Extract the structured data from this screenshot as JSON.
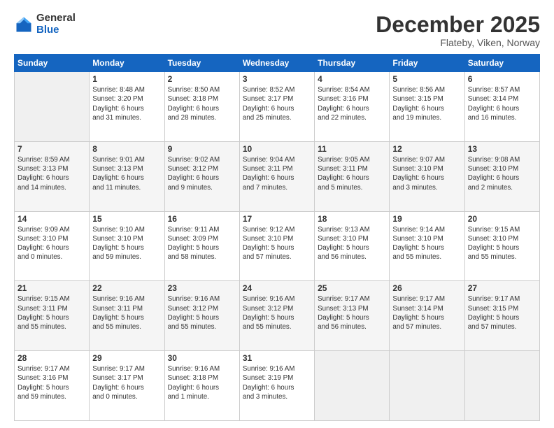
{
  "logo": {
    "general": "General",
    "blue": "Blue"
  },
  "title": {
    "month": "December 2025",
    "location": "Flateby, Viken, Norway"
  },
  "header_days": [
    "Sunday",
    "Monday",
    "Tuesday",
    "Wednesday",
    "Thursday",
    "Friday",
    "Saturday"
  ],
  "weeks": [
    [
      {
        "day": "",
        "info": ""
      },
      {
        "day": "1",
        "info": "Sunrise: 8:48 AM\nSunset: 3:20 PM\nDaylight: 6 hours\nand 31 minutes."
      },
      {
        "day": "2",
        "info": "Sunrise: 8:50 AM\nSunset: 3:18 PM\nDaylight: 6 hours\nand 28 minutes."
      },
      {
        "day": "3",
        "info": "Sunrise: 8:52 AM\nSunset: 3:17 PM\nDaylight: 6 hours\nand 25 minutes."
      },
      {
        "day": "4",
        "info": "Sunrise: 8:54 AM\nSunset: 3:16 PM\nDaylight: 6 hours\nand 22 minutes."
      },
      {
        "day": "5",
        "info": "Sunrise: 8:56 AM\nSunset: 3:15 PM\nDaylight: 6 hours\nand 19 minutes."
      },
      {
        "day": "6",
        "info": "Sunrise: 8:57 AM\nSunset: 3:14 PM\nDaylight: 6 hours\nand 16 minutes."
      }
    ],
    [
      {
        "day": "7",
        "info": "Sunrise: 8:59 AM\nSunset: 3:13 PM\nDaylight: 6 hours\nand 14 minutes."
      },
      {
        "day": "8",
        "info": "Sunrise: 9:01 AM\nSunset: 3:13 PM\nDaylight: 6 hours\nand 11 minutes."
      },
      {
        "day": "9",
        "info": "Sunrise: 9:02 AM\nSunset: 3:12 PM\nDaylight: 6 hours\nand 9 minutes."
      },
      {
        "day": "10",
        "info": "Sunrise: 9:04 AM\nSunset: 3:11 PM\nDaylight: 6 hours\nand 7 minutes."
      },
      {
        "day": "11",
        "info": "Sunrise: 9:05 AM\nSunset: 3:11 PM\nDaylight: 6 hours\nand 5 minutes."
      },
      {
        "day": "12",
        "info": "Sunrise: 9:07 AM\nSunset: 3:10 PM\nDaylight: 6 hours\nand 3 minutes."
      },
      {
        "day": "13",
        "info": "Sunrise: 9:08 AM\nSunset: 3:10 PM\nDaylight: 6 hours\nand 2 minutes."
      }
    ],
    [
      {
        "day": "14",
        "info": "Sunrise: 9:09 AM\nSunset: 3:10 PM\nDaylight: 6 hours\nand 0 minutes."
      },
      {
        "day": "15",
        "info": "Sunrise: 9:10 AM\nSunset: 3:10 PM\nDaylight: 5 hours\nand 59 minutes."
      },
      {
        "day": "16",
        "info": "Sunrise: 9:11 AM\nSunset: 3:09 PM\nDaylight: 5 hours\nand 58 minutes."
      },
      {
        "day": "17",
        "info": "Sunrise: 9:12 AM\nSunset: 3:10 PM\nDaylight: 5 hours\nand 57 minutes."
      },
      {
        "day": "18",
        "info": "Sunrise: 9:13 AM\nSunset: 3:10 PM\nDaylight: 5 hours\nand 56 minutes."
      },
      {
        "day": "19",
        "info": "Sunrise: 9:14 AM\nSunset: 3:10 PM\nDaylight: 5 hours\nand 55 minutes."
      },
      {
        "day": "20",
        "info": "Sunrise: 9:15 AM\nSunset: 3:10 PM\nDaylight: 5 hours\nand 55 minutes."
      }
    ],
    [
      {
        "day": "21",
        "info": "Sunrise: 9:15 AM\nSunset: 3:11 PM\nDaylight: 5 hours\nand 55 minutes."
      },
      {
        "day": "22",
        "info": "Sunrise: 9:16 AM\nSunset: 3:11 PM\nDaylight: 5 hours\nand 55 minutes."
      },
      {
        "day": "23",
        "info": "Sunrise: 9:16 AM\nSunset: 3:12 PM\nDaylight: 5 hours\nand 55 minutes."
      },
      {
        "day": "24",
        "info": "Sunrise: 9:16 AM\nSunset: 3:12 PM\nDaylight: 5 hours\nand 55 minutes."
      },
      {
        "day": "25",
        "info": "Sunrise: 9:17 AM\nSunset: 3:13 PM\nDaylight: 5 hours\nand 56 minutes."
      },
      {
        "day": "26",
        "info": "Sunrise: 9:17 AM\nSunset: 3:14 PM\nDaylight: 5 hours\nand 57 minutes."
      },
      {
        "day": "27",
        "info": "Sunrise: 9:17 AM\nSunset: 3:15 PM\nDaylight: 5 hours\nand 57 minutes."
      }
    ],
    [
      {
        "day": "28",
        "info": "Sunrise: 9:17 AM\nSunset: 3:16 PM\nDaylight: 5 hours\nand 59 minutes."
      },
      {
        "day": "29",
        "info": "Sunrise: 9:17 AM\nSunset: 3:17 PM\nDaylight: 6 hours\nand 0 minutes."
      },
      {
        "day": "30",
        "info": "Sunrise: 9:16 AM\nSunset: 3:18 PM\nDaylight: 6 hours\nand 1 minute."
      },
      {
        "day": "31",
        "info": "Sunrise: 9:16 AM\nSunset: 3:19 PM\nDaylight: 6 hours\nand 3 minutes."
      },
      {
        "day": "",
        "info": ""
      },
      {
        "day": "",
        "info": ""
      },
      {
        "day": "",
        "info": ""
      }
    ]
  ]
}
